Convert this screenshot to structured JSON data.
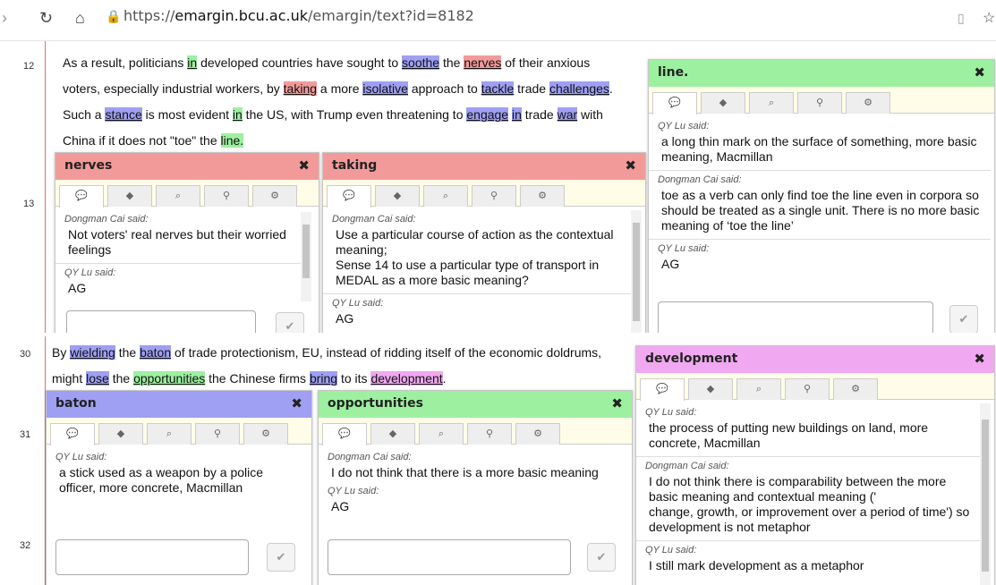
{
  "browser": {
    "url_prefix": "https://",
    "url_host": "emargin.bcu.ac.uk",
    "url_path": "/emargin/text?id=8182"
  },
  "top": {
    "line_numbers": [
      "12",
      "13"
    ],
    "para": {
      "l1": [
        "As a result, politicians ",
        "in",
        " developed countries have sought to ",
        "soothe",
        " the ",
        "nerves",
        " of their anxious"
      ],
      "l2": [
        "voters, especially industrial workers, by ",
        "taking",
        " a more ",
        "isolative",
        " approach to ",
        "tackle",
        " trade ",
        "challenges",
        "."
      ],
      "l3": [
        "Such a ",
        "stance",
        " is most evident ",
        "in",
        " the US, with Trump even threatening to ",
        "engage",
        " ",
        "in",
        " trade ",
        "war",
        " with"
      ],
      "l4": [
        "China if it does not \"toe\" the ",
        "line."
      ]
    }
  },
  "bottom": {
    "line_numbers": [
      "30",
      "31",
      "32"
    ],
    "para": {
      "l1": [
        "By ",
        "wielding",
        " the ",
        "baton",
        " of trade protectionism, EU, instead of ridding itself of the economic doldrums,"
      ],
      "l2": [
        "might ",
        "lose",
        " the ",
        "opportunities",
        " the Chinese firms ",
        "bring",
        " to its ",
        "development",
        "."
      ]
    }
  },
  "cards": {
    "nerves": {
      "title": "nerves",
      "c1_who": "Dongman Cai said:",
      "c1_text": "Not voters' real nerves but their worried feelings",
      "c2_who": "QY Lu said:",
      "c2_text": "AG"
    },
    "taking": {
      "title": "taking",
      "c1_who": "Dongman Cai said:",
      "c1_text": "Use a particular course of action as the contextual meaning;",
      "c1_text2": "Sense 14 to use a particular type of transport in MEDAL as a more basic meaning?",
      "c2_who": "QY Lu said:",
      "c2_text": "AG"
    },
    "line": {
      "title": "line.",
      "c1_who": "QY Lu said:",
      "c1_text": "a long thin mark on the surface of something, more basic meaning, Macmillan",
      "c2_who": "Dongman Cai said:",
      "c2_text": "toe as a verb can only find toe the line even in corpora so should be treated as a single unit. There is no more basic meaning of ‘toe the line’",
      "c3_who": "QY Lu said:",
      "c3_text": "AG"
    },
    "development": {
      "title": "development",
      "c1_who": "QY Lu said:",
      "c1_text": "the process of putting new buildings on land, more concrete, Macmillan",
      "c2_who": "Dongman Cai said:",
      "c2_text": "I do not think there is comparability between the more basic meaning and contextual meaning ('",
      "c2_text2": "change, growth, or improvement over a period of time') so development is not metaphor",
      "c3_who": "QY Lu said:",
      "c3_text": "I still mark development as a metaphor"
    },
    "baton": {
      "title": "baton",
      "c1_who": "QY Lu said:",
      "c1_text": "a stick used as a weapon by a police officer, more concrete, Macmillan"
    },
    "opportunities": {
      "title": "opportunities",
      "c1_who": "Dongman Cai said:",
      "c1_text": "I do not think that there is a more basic meaning",
      "c2_who": "QY Lu said:",
      "c2_text": "AG"
    }
  },
  "colors": {
    "red": "#f29a9a",
    "blue": "#9f9ff3",
    "green": "#9cf0a0",
    "pink": "#f0a8f0"
  },
  "icons": {
    "tabs": [
      "comment-icon",
      "tag-icon",
      "search-icon",
      "link-icon",
      "settings-icon"
    ],
    "ok": "check-icon",
    "close": "close-icon"
  }
}
